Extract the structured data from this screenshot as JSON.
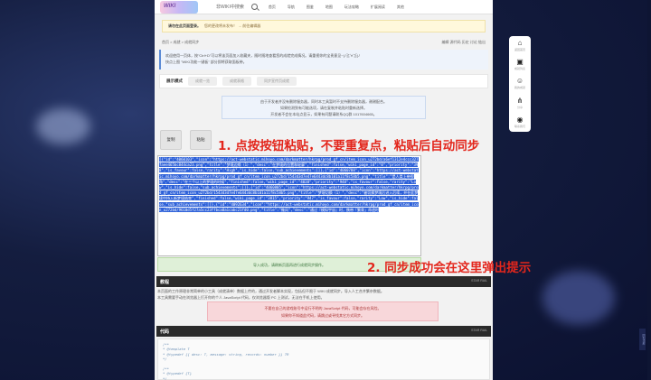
{
  "nav": {
    "logo_text": "WIKI",
    "site_name": "非WIKI中搜索",
    "links": [
      "首页",
      "导航",
      "图鉴",
      "地图",
      "玩法攻略",
      "扩展阅读",
      "其他"
    ]
  },
  "notice": {
    "strong": "请勿在此页面登录。",
    "text": "您的更改将未发布！ → 前往编辑器"
  },
  "breadcrumb": {
    "path": "首页 > 成就 > 成就同步",
    "actions": "编辑 源代码 历史 讨论 链出"
  },
  "infobox": {
    "line1": "欢迎使用一页体，按\"Ctrl+D\"可以将该页面加入收藏夹，随时随地查看您的成就完成情况。请重视你的宝贵意见~(ﾉ≧∀≦)ﾉ",
    "line2": "快点上图 \"WIKI功能一键板\" 部分即将获取面板带。"
  },
  "mode": {
    "label": "展示模式",
    "buttons": [
      "成就一览",
      "成就表格",
      "同步宣传页成就"
    ]
  },
  "hint": {
    "line1": "由于开发者并没有删除服务器，同时本工具暂时不支持删除服务器，谢谢配合。",
    "line2": "如果检测到有可能选项，请在复制并粘贴时重新选择。",
    "line3": "开发者不会在本站点显示，如果有问题请联系QQ群 1017604665。"
  },
  "buttons": {
    "copy": "复制",
    "paste": "粘贴"
  },
  "json_dump": "[{\"id\":\"4060103\",\"icon\":\"https://act-webstatic.mihoyo.com/darkmatter/hkrpg/prod_gf_cn/item_icon_u272bd/a6ef1312e4ccc327faee465bc844ca23.png\",\"title\":\"梦境边缘（1）\",\"desc\":\"在梦境的位置和轮廓\",\"finished\":false,\"wiki_page_id\":\"0\",\"priority\":\"398\",\"is_favour\":false,\"rarity\":\"High\",\"is_hide\":false,\"sub_achievements\":[]},{\"id\":\"4060788\",\"icon\":\"https://act-webstatic.mihoyo.com/darkmatter/hkrpg/prod_gf_cn/item_icon_u272bd/1543d3d7e47e6443dc8b101a11f8c58b5.png\",\"title\":\"是人类上帝视角\",\"desc\":\"在三个以上的梦境的时候\",\"finished\":false,\"wiki_page_id\":\"4038\",\"priority\":\"948\",\"is_favour\":false,\"rarity\":\"Low\",\"is_hide\":false,\"sub_achievements\":[]},{\"id\":\"4060805\",\"icon\":\"https://act-webstatic.mihoyo.com/darkmatter/hkrpg/prod_gf_cn/item_icon_u272bd/1543d3d7e47e6443dc8b101a11f8c58b5.png\",\"title\":\"梦境切换（1）\",\"desc\":\"被切换梦境后进入后续，并在此梦境中持入新梦境结束\",\"finished\":false,\"wiki_page_id\":\"3815\",\"priority\":\"947\",\"is_favour\":false,\"rarity\":\"Low\",\"is_hide\":false,\"sub_achievements\":[]},{\"id\":\"4092634\",\"icon\":\"https://act-webstatic.mihoyo.com/darkmatter/hkrpg/prod_gf_cn/item_icon_u272bd/9610d5f27a5cc23ffbca8a1cabc21fd0.png\",\"title\":\"微风\",\"desc\":\"通过『模拟宇宙』时，携带「繁育」命途时",
  "success_msg": "导入成功，请刷新页面再进行成就同步操作。",
  "annotations": {
    "step1": "1. 点按按钮粘贴，不要重复点，粘贴后自动同步",
    "step2": "2. 同步成功会在这里弹出提示"
  },
  "tutorial": {
    "title": "教程",
    "tag": "STAR RAIL",
    "line1": "本页面的工作原理非常简单的小工具（成就清单）数据上传的，通过开发者脚本实现，包括但不限于 WIKI 成就同步。导入人工合并繁杂数据。",
    "line2": "本工具需要手动在浏览器上打开你的个人 JavaScript 代码，仅浏览器版 PC 上测试，无法在手机上使用。",
    "warn1": "不要在自己的游戏账号中运行不明的 JavaScript 代码，可能会存在风险。",
    "warn2": "如果你不知道此代码，请跳过或寻找其它方式同步。"
  },
  "code": {
    "title": "代码",
    "tag": "STAR RAIL",
    "lines": [
      "/**",
      " * @template T",
      " * @typedef {{ desc: T, message: string, records: number }} TR",
      " */",
      "",
      "/**",
      " * @typedef {T}",
      " */"
    ]
  },
  "sidebar": {
    "items": [
      {
        "icon": "⌂",
        "label": "返回首页"
      },
      {
        "icon": "▣",
        "label": "成就列表"
      },
      {
        "icon": "☺",
        "label": "我的成就"
      },
      {
        "icon": "⋔",
        "label": "分享"
      },
      {
        "icon": "◉",
        "label": "联系我们"
      }
    ]
  },
  "scroll_label": "回到顶部"
}
